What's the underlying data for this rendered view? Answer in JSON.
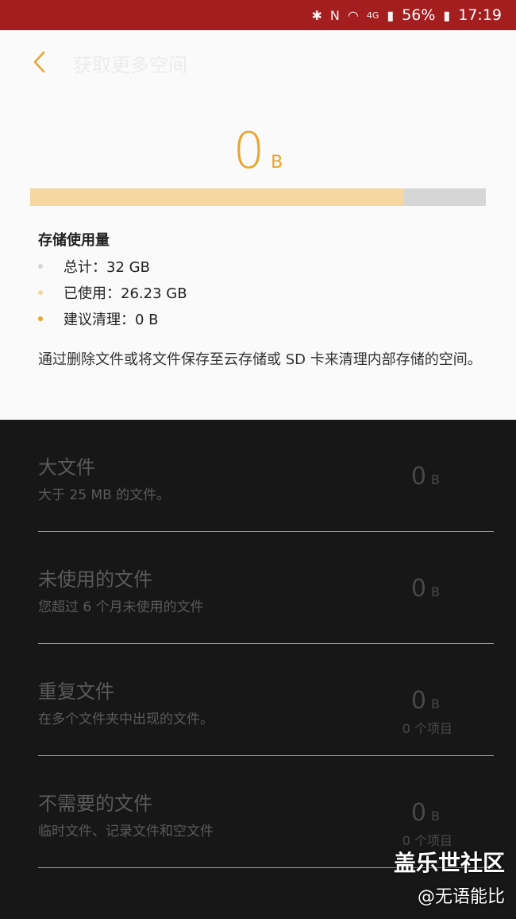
{
  "status_bar": {
    "icons": [
      "bluetooth-icon",
      "nfc-icon",
      "wifi-icon",
      "4g-icon",
      "signal-icon"
    ],
    "battery": "56%",
    "time": "17:19",
    "color": "#a41d1f"
  },
  "header": {
    "title": "获取更多空间"
  },
  "summary": {
    "total_value": "0",
    "total_unit": "B",
    "usage_fraction": 0.8197
  },
  "storage": {
    "heading": "存储使用量",
    "items": [
      {
        "label": "总计：32 GB",
        "color": "#d6d6d6"
      },
      {
        "label": "已使用：26.23 GB",
        "color": "#f5d79f"
      },
      {
        "label": "建议清理：0 B",
        "color": "#e8a530"
      }
    ],
    "description": "通过删除文件或将文件保存至云存储或 SD 卡来清理内部存储的空间。"
  },
  "categories": [
    {
      "title": "大文件",
      "desc": "大于 25 MB 的文件。",
      "size": "0",
      "unit": "B",
      "items": ""
    },
    {
      "title": "未使用的文件",
      "desc": "您超过 6 个月未使用的文件",
      "size": "0",
      "unit": "B",
      "items": ""
    },
    {
      "title": "重复文件",
      "desc": "在多个文件夹中出现的文件。",
      "size": "0",
      "unit": "B",
      "items": "0 个项目"
    },
    {
      "title": "不需要的文件",
      "desc": "临时文件、记录文件和空文件",
      "size": "0",
      "unit": "B",
      "items": "0 个项目"
    }
  ],
  "watermark": {
    "title": "盖乐世社区",
    "sub": "@无语能比"
  },
  "colors": {
    "accent": "#e8a530",
    "light_panel": "#fafafa",
    "dark_panel": "#171717"
  }
}
